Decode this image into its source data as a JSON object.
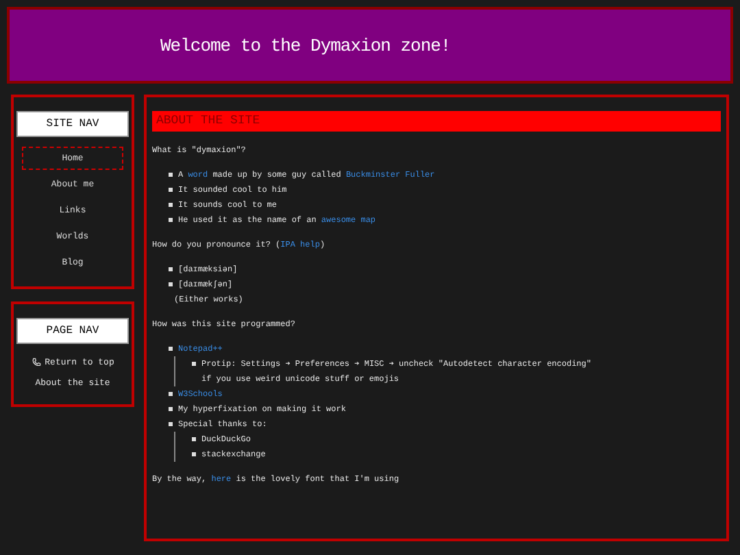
{
  "header": {
    "title": "Welcome to the Dymaxion zone!"
  },
  "site_nav": {
    "title": "SITE NAV",
    "items": [
      {
        "label": "Home",
        "selected": true
      },
      {
        "label": "About me",
        "selected": false
      },
      {
        "label": "Links",
        "selected": false
      },
      {
        "label": "Worlds",
        "selected": false
      },
      {
        "label": "Blog",
        "selected": false
      }
    ]
  },
  "page_nav": {
    "title": "PAGE NAV",
    "items": [
      {
        "label": "Return to top",
        "kind": "phone"
      },
      {
        "label": "About the site",
        "kind": "plain"
      }
    ]
  },
  "main": {
    "heading": "ABOUT THE SITE",
    "blocks": [
      {
        "kind": "para",
        "segments": [
          {
            "text": "What is \"dymaxion\"?",
            "link": false
          }
        ]
      },
      {
        "kind": "list",
        "items": [
          {
            "segments": [
              {
                "text": "A ",
                "link": false
              },
              {
                "text": "word",
                "link": true
              },
              {
                "text": " made up by some guy called ",
                "link": false
              },
              {
                "text": "Buckminster Fuller",
                "link": true
              }
            ]
          },
          {
            "segments": [
              {
                "text": "It sounded cool to him",
                "link": false
              }
            ]
          },
          {
            "segments": [
              {
                "text": "It sounds cool to me",
                "link": false
              }
            ]
          },
          {
            "segments": [
              {
                "text": "He used it as the name of an ",
                "link": false
              },
              {
                "text": "awesome map",
                "link": true
              }
            ]
          }
        ]
      },
      {
        "kind": "para",
        "segments": [
          {
            "text": "How do you pronounce it? (",
            "link": false
          },
          {
            "text": "IPA help",
            "link": true
          },
          {
            "text": ")",
            "link": false
          }
        ]
      },
      {
        "kind": "list",
        "items": [
          {
            "segments": [
              {
                "text": "[daɪmæksiən]",
                "link": false
              }
            ]
          },
          {
            "segments": [
              {
                "text": "[daɪmækʃən]",
                "link": false
              }
            ]
          }
        ],
        "note": "(Either works)"
      },
      {
        "kind": "para",
        "segments": [
          {
            "text": "How was this site programmed?",
            "link": false
          }
        ]
      },
      {
        "kind": "list",
        "items": [
          {
            "segments": [
              {
                "text": "Notepad++",
                "link": true
              }
            ],
            "children": [
              {
                "segments": [
                  {
                    "text": "Protip: Settings ➔ Preferences ➔ MISC ➔ uncheck \"Autodetect character encoding\"\nif you use weird unicode stuff or emojis",
                    "link": false
                  }
                ]
              }
            ]
          },
          {
            "segments": [
              {
                "text": "W3Schools",
                "link": true
              }
            ]
          },
          {
            "segments": [
              {
                "text": "My hyperfixation on making it work",
                "link": false
              }
            ]
          },
          {
            "segments": [
              {
                "text": "Special thanks to:",
                "link": false
              }
            ],
            "children": [
              {
                "segments": [
                  {
                    "text": "DuckDuckGo",
                    "link": false
                  }
                ]
              },
              {
                "segments": [
                  {
                    "text": "stackexchange",
                    "link": false
                  }
                ]
              }
            ]
          }
        ]
      },
      {
        "kind": "para",
        "segments": [
          {
            "text": "By the way, ",
            "link": false
          },
          {
            "text": "here",
            "link": true
          },
          {
            "text": " is the lovely font that I'm using",
            "link": false
          }
        ]
      }
    ]
  }
}
